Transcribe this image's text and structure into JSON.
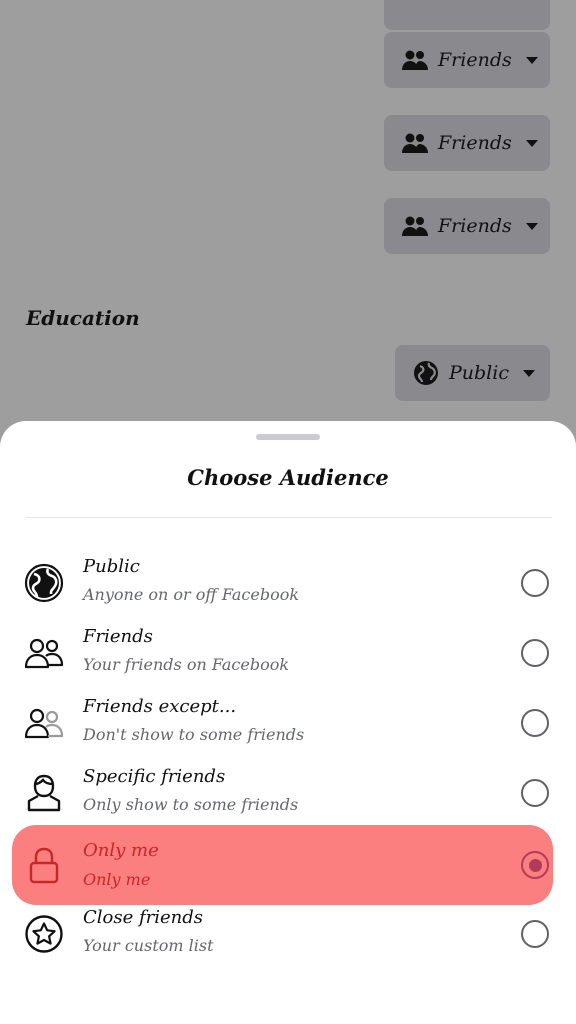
{
  "background": {
    "audience_buttons": [
      {
        "label": "Friends",
        "icon": "people-icon"
      },
      {
        "label": "Friends",
        "icon": "people-icon"
      },
      {
        "label": "Friends",
        "icon": "people-icon"
      }
    ],
    "section_heading": "Education",
    "education_button": {
      "label": "Public",
      "icon": "globe-icon"
    }
  },
  "sheet": {
    "title": "Choose Audience",
    "options": [
      {
        "title": "Public",
        "subtitle": "Anyone on or off Facebook",
        "icon": "globe-icon",
        "selected": false
      },
      {
        "title": "Friends",
        "subtitle": "Your friends on Facebook",
        "icon": "friends-icon",
        "selected": false
      },
      {
        "title": "Friends except...",
        "subtitle": "Don't show to some friends",
        "icon": "friends-except-icon",
        "selected": false
      },
      {
        "title": "Specific friends",
        "subtitle": "Only show to some friends",
        "icon": "specific-friend-icon",
        "selected": false
      },
      {
        "title": "Only me",
        "subtitle": "Only me",
        "icon": "lock-icon",
        "selected": true
      },
      {
        "title": "Close friends",
        "subtitle": "Your custom list",
        "icon": "star-icon",
        "selected": false
      }
    ]
  },
  "colors": {
    "overlay": "#9e9e9e",
    "selected_highlight": "#fb7f7f",
    "selected_text": "#c62828",
    "radio_selected": "#b23a5a"
  }
}
